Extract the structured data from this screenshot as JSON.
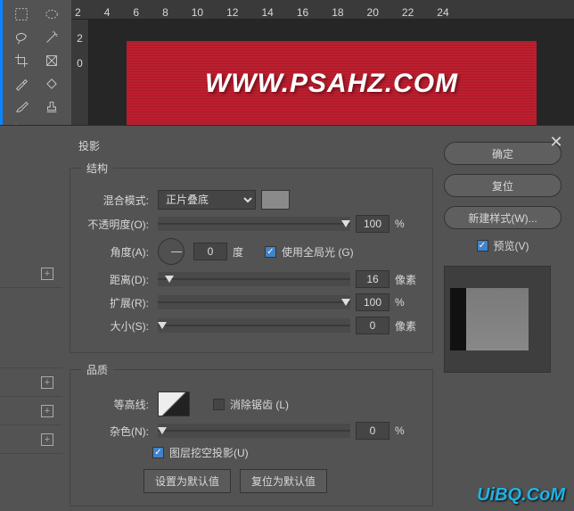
{
  "ruler_top": [
    "2",
    "4",
    "6",
    "8",
    "10",
    "12",
    "14",
    "16",
    "18",
    "20",
    "22",
    "24"
  ],
  "ruler_left": [
    "2",
    "0"
  ],
  "canvas_text": "WWW.PSAHZ.COM",
  "dialog": {
    "section": "投影",
    "group_structure": "结构",
    "group_quality": "品质",
    "blend_mode_label": "混合模式:",
    "blend_mode_value": "正片叠底",
    "opacity_label": "不透明度(O):",
    "opacity_value": "100",
    "opacity_unit": "%",
    "angle_label": "角度(A):",
    "angle_value": "0",
    "angle_unit": "度",
    "use_global_label": "使用全局光 (G)",
    "distance_label": "距离(D):",
    "distance_value": "16",
    "distance_unit": "像素",
    "spread_label": "扩展(R):",
    "spread_value": "100",
    "spread_unit": "%",
    "size_label": "大小(S):",
    "size_value": "0",
    "size_unit": "像素",
    "contour_label": "等高线:",
    "antialias_label": "消除锯齿 (L)",
    "noise_label": "杂色(N):",
    "noise_value": "0",
    "noise_unit": "%",
    "knockout_label": "图层挖空投影(U)",
    "btn_default": "设置为默认值",
    "btn_reset": "复位为默认值"
  },
  "buttons": {
    "ok": "确定",
    "cancel": "复位",
    "new_style": "新建样式(W)...",
    "preview": "预览(V)"
  },
  "watermark": "UiBQ.CoM"
}
